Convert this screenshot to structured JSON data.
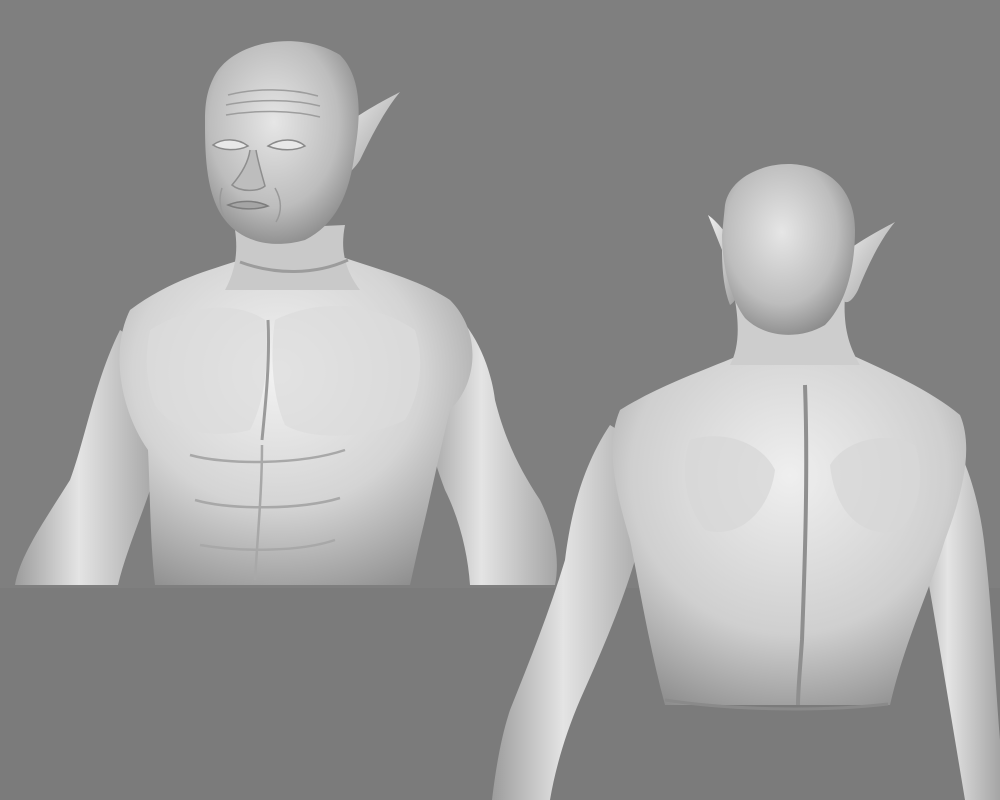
{
  "scene": {
    "colors": {
      "background_top": "#7f7f7f",
      "background_bottom": "#7b7b7b",
      "sculpt_light": "#ececec",
      "sculpt_mid": "#bdbdbd",
      "sculpt_shadow": "#6f6f6f"
    },
    "views": [
      "front",
      "back"
    ]
  }
}
